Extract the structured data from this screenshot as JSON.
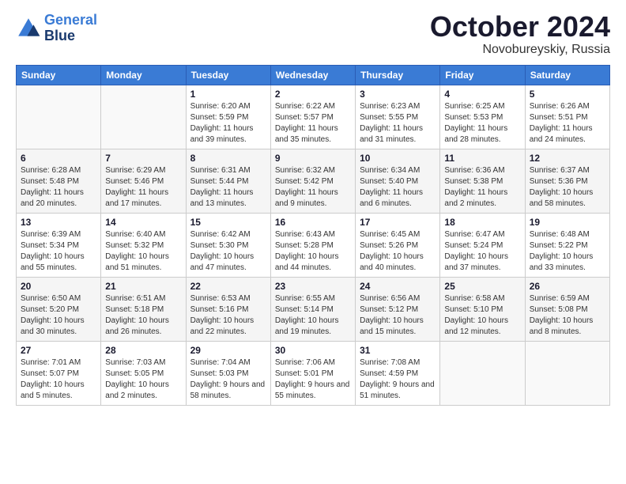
{
  "header": {
    "logo_line1": "General",
    "logo_line2": "Blue",
    "month": "October 2024",
    "location": "Novobureyskiy, Russia"
  },
  "days_of_week": [
    "Sunday",
    "Monday",
    "Tuesday",
    "Wednesday",
    "Thursday",
    "Friday",
    "Saturday"
  ],
  "weeks": [
    [
      {
        "day": "",
        "detail": ""
      },
      {
        "day": "",
        "detail": ""
      },
      {
        "day": "1",
        "detail": "Sunrise: 6:20 AM\nSunset: 5:59 PM\nDaylight: 11 hours and 39 minutes."
      },
      {
        "day": "2",
        "detail": "Sunrise: 6:22 AM\nSunset: 5:57 PM\nDaylight: 11 hours and 35 minutes."
      },
      {
        "day": "3",
        "detail": "Sunrise: 6:23 AM\nSunset: 5:55 PM\nDaylight: 11 hours and 31 minutes."
      },
      {
        "day": "4",
        "detail": "Sunrise: 6:25 AM\nSunset: 5:53 PM\nDaylight: 11 hours and 28 minutes."
      },
      {
        "day": "5",
        "detail": "Sunrise: 6:26 AM\nSunset: 5:51 PM\nDaylight: 11 hours and 24 minutes."
      }
    ],
    [
      {
        "day": "6",
        "detail": "Sunrise: 6:28 AM\nSunset: 5:48 PM\nDaylight: 11 hours and 20 minutes."
      },
      {
        "day": "7",
        "detail": "Sunrise: 6:29 AM\nSunset: 5:46 PM\nDaylight: 11 hours and 17 minutes."
      },
      {
        "day": "8",
        "detail": "Sunrise: 6:31 AM\nSunset: 5:44 PM\nDaylight: 11 hours and 13 minutes."
      },
      {
        "day": "9",
        "detail": "Sunrise: 6:32 AM\nSunset: 5:42 PM\nDaylight: 11 hours and 9 minutes."
      },
      {
        "day": "10",
        "detail": "Sunrise: 6:34 AM\nSunset: 5:40 PM\nDaylight: 11 hours and 6 minutes."
      },
      {
        "day": "11",
        "detail": "Sunrise: 6:36 AM\nSunset: 5:38 PM\nDaylight: 11 hours and 2 minutes."
      },
      {
        "day": "12",
        "detail": "Sunrise: 6:37 AM\nSunset: 5:36 PM\nDaylight: 10 hours and 58 minutes."
      }
    ],
    [
      {
        "day": "13",
        "detail": "Sunrise: 6:39 AM\nSunset: 5:34 PM\nDaylight: 10 hours and 55 minutes."
      },
      {
        "day": "14",
        "detail": "Sunrise: 6:40 AM\nSunset: 5:32 PM\nDaylight: 10 hours and 51 minutes."
      },
      {
        "day": "15",
        "detail": "Sunrise: 6:42 AM\nSunset: 5:30 PM\nDaylight: 10 hours and 47 minutes."
      },
      {
        "day": "16",
        "detail": "Sunrise: 6:43 AM\nSunset: 5:28 PM\nDaylight: 10 hours and 44 minutes."
      },
      {
        "day": "17",
        "detail": "Sunrise: 6:45 AM\nSunset: 5:26 PM\nDaylight: 10 hours and 40 minutes."
      },
      {
        "day": "18",
        "detail": "Sunrise: 6:47 AM\nSunset: 5:24 PM\nDaylight: 10 hours and 37 minutes."
      },
      {
        "day": "19",
        "detail": "Sunrise: 6:48 AM\nSunset: 5:22 PM\nDaylight: 10 hours and 33 minutes."
      }
    ],
    [
      {
        "day": "20",
        "detail": "Sunrise: 6:50 AM\nSunset: 5:20 PM\nDaylight: 10 hours and 30 minutes."
      },
      {
        "day": "21",
        "detail": "Sunrise: 6:51 AM\nSunset: 5:18 PM\nDaylight: 10 hours and 26 minutes."
      },
      {
        "day": "22",
        "detail": "Sunrise: 6:53 AM\nSunset: 5:16 PM\nDaylight: 10 hours and 22 minutes."
      },
      {
        "day": "23",
        "detail": "Sunrise: 6:55 AM\nSunset: 5:14 PM\nDaylight: 10 hours and 19 minutes."
      },
      {
        "day": "24",
        "detail": "Sunrise: 6:56 AM\nSunset: 5:12 PM\nDaylight: 10 hours and 15 minutes."
      },
      {
        "day": "25",
        "detail": "Sunrise: 6:58 AM\nSunset: 5:10 PM\nDaylight: 10 hours and 12 minutes."
      },
      {
        "day": "26",
        "detail": "Sunrise: 6:59 AM\nSunset: 5:08 PM\nDaylight: 10 hours and 8 minutes."
      }
    ],
    [
      {
        "day": "27",
        "detail": "Sunrise: 7:01 AM\nSunset: 5:07 PM\nDaylight: 10 hours and 5 minutes."
      },
      {
        "day": "28",
        "detail": "Sunrise: 7:03 AM\nSunset: 5:05 PM\nDaylight: 10 hours and 2 minutes."
      },
      {
        "day": "29",
        "detail": "Sunrise: 7:04 AM\nSunset: 5:03 PM\nDaylight: 9 hours and 58 minutes."
      },
      {
        "day": "30",
        "detail": "Sunrise: 7:06 AM\nSunset: 5:01 PM\nDaylight: 9 hours and 55 minutes."
      },
      {
        "day": "31",
        "detail": "Sunrise: 7:08 AM\nSunset: 4:59 PM\nDaylight: 9 hours and 51 minutes."
      },
      {
        "day": "",
        "detail": ""
      },
      {
        "day": "",
        "detail": ""
      }
    ]
  ]
}
